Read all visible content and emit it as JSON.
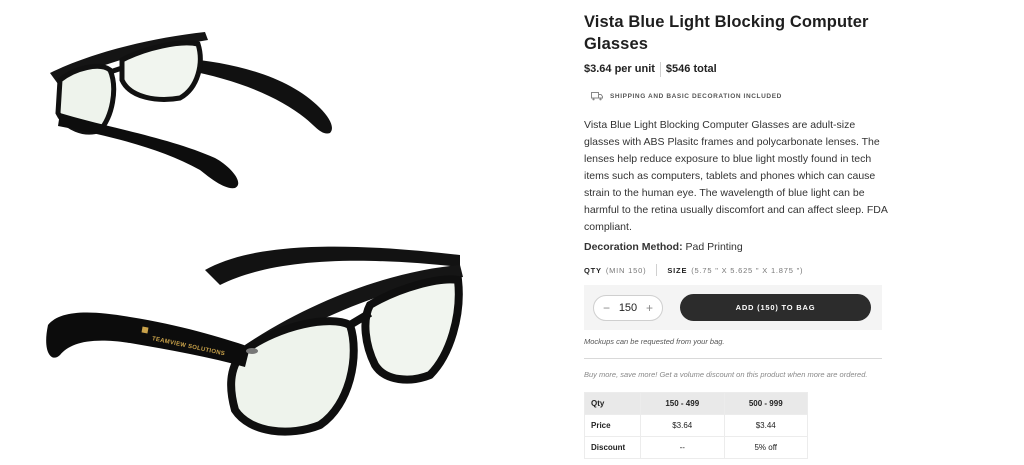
{
  "product": {
    "title": "Vista Blue Light Blocking Computer Glasses",
    "price_per_unit": "$3.64 per unit",
    "price_total": "$546 total",
    "shipping_note": "SHIPPING AND BASIC DECORATION INCLUDED",
    "description": "Vista Blue Light Blocking Computer Glasses are adult-size glasses with ABS Plasitc frames and polycarbonate lenses. The lenses help reduce exposure to blue light mostly found in tech items such as computers, tablets and phones which can cause strain to the human eye. The wavelength of blue light can be harmful to the retina usually discomfort and can affect sleep. FDA compliant.",
    "decoration_label": "Decoration Method:",
    "decoration_value": "Pad Printing",
    "imprint_text": "TEAMVIEW SOLUTIONS"
  },
  "specs": {
    "qty_label": "QTY",
    "qty_value": "(MIN 150)",
    "size_label": "SIZE",
    "size_value": "(5.75 \" X 5.625 \" X 1.875 \")"
  },
  "cart": {
    "minus": "−",
    "quantity": "150",
    "plus": "+",
    "add_button": "ADD (150) TO BAG",
    "mockup_note": "Mockups can be requested from your bag."
  },
  "volume": {
    "note": "Buy more, save more! Get a volume discount on this product when more are ordered.",
    "header": [
      "Qty",
      "150 - 499",
      "500 - 999"
    ],
    "rows": [
      [
        "Price",
        "$3.64",
        "$3.44"
      ],
      [
        "Discount",
        "--",
        "5% off"
      ]
    ]
  },
  "icons": [
    "truck-icon",
    "minus-icon",
    "plus-icon"
  ],
  "colors": {
    "button_bg": "#2c2c2c",
    "cart_bg": "#f4f4f4",
    "imprint": "#c9a24a"
  }
}
